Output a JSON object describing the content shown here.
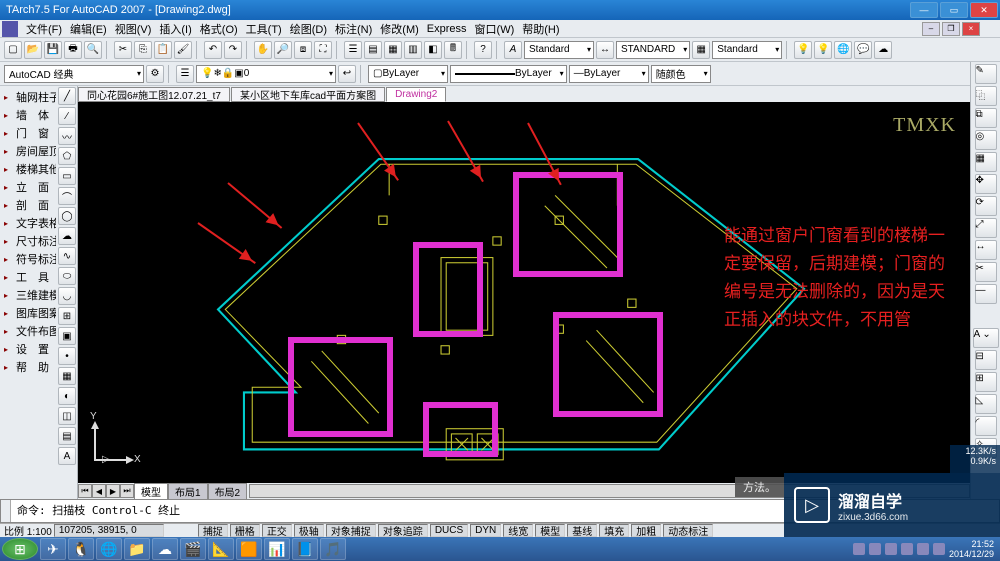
{
  "title": "TArch7.5 For AutoCAD 2007 - [Drawing2.dwg]",
  "menu": [
    "文件(F)",
    "编辑(E)",
    "视图(V)",
    "插入(I)",
    "格式(O)",
    "工具(T)",
    "绘图(D)",
    "标注(N)",
    "修改(M)",
    "Express",
    "窗口(W)",
    "帮助(H)"
  ],
  "dimstyle": {
    "a": "Standard",
    "b": "STANDARD",
    "c": "Standard"
  },
  "layer": {
    "combo": "AutoCAD 经典",
    "current": "0",
    "color": "ByLayer",
    "line": "ByLayer",
    "weight": "ByLayer",
    "pcolor": "随颜色"
  },
  "filetabs": [
    "同心花园6#施工图12.07.21_t7",
    "某小区地下车库cad平面方案图",
    "Drawing2"
  ],
  "sheettabs": [
    "模型",
    "布局1",
    "布局2"
  ],
  "sidebar": [
    "轴网柱子",
    "墙　体",
    "门　窗",
    "房间屋顶",
    "楼梯其他",
    "立　面",
    "剖　面",
    "文字表格",
    "尺寸标注",
    "符号标注",
    "工　具",
    "三维建模",
    "图库图案",
    "文件布图",
    "设　置",
    "帮　助"
  ],
  "watermark": "TMXK",
  "overlay": "能通过窗户门窗看到的楼梯一定要保留，后期建模；门窗的编号是无法删除的，因为是天正插入的块文件，不用管",
  "command": "命令: 扫描枝 Control-C 终止",
  "status": {
    "scale": "比例 1:100",
    "coords": "107205, 38915, 0",
    "modes": [
      "捕捉",
      "栅格",
      "正交",
      "极轴",
      "对象捕捉",
      "对象追踪",
      "DUCS",
      "DYN",
      "线宽",
      "模型",
      "基线",
      "填充",
      "加粗",
      "动态标注"
    ]
  },
  "tray": {
    "time": "21:52",
    "date": "2014/12/29"
  },
  "speed": {
    "down": "12.3K/s",
    "up": "0.9K/s"
  },
  "brand": {
    "zh": "溜溜自学",
    "url": "zixue.3d66.com"
  },
  "tip": "方法。",
  "ucs": {
    "x": "X",
    "y": "Y"
  },
  "annot": "A"
}
